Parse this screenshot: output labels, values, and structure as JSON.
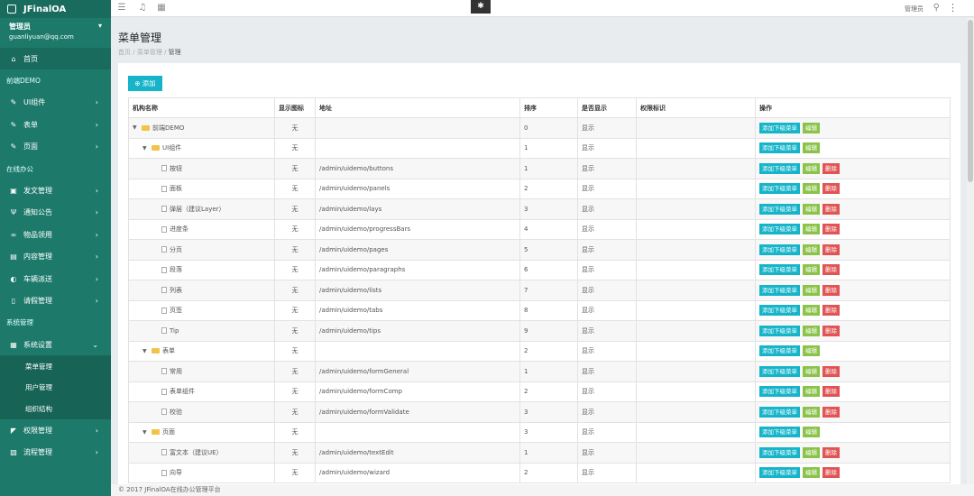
{
  "app": {
    "title": "JFinalOA"
  },
  "user": {
    "role": "管理员",
    "email": "guanliyuan@qq.com"
  },
  "sidebar": {
    "items": [
      {
        "type": "item",
        "label": "首页",
        "icon": "home-icon",
        "glyph": "⌂",
        "active": true
      },
      {
        "type": "header",
        "label": "前端DEMO"
      },
      {
        "type": "item",
        "label": "UI组件",
        "icon": "pencil-icon",
        "glyph": "✎",
        "chevron": "›"
      },
      {
        "type": "item",
        "label": "表单",
        "icon": "pencil-icon",
        "glyph": "✎",
        "chevron": "›"
      },
      {
        "type": "item",
        "label": "页面",
        "icon": "pencil-icon",
        "glyph": "✎",
        "chevron": "›"
      },
      {
        "type": "header",
        "label": "在线办公"
      },
      {
        "type": "item",
        "label": "发文管理",
        "icon": "calendar-icon",
        "glyph": "▣",
        "chevron": "›"
      },
      {
        "type": "item",
        "label": "通知公告",
        "icon": "antenna-icon",
        "glyph": "Ψ",
        "chevron": "›"
      },
      {
        "type": "item",
        "label": "物品领用",
        "icon": "link-icon",
        "glyph": "∞",
        "chevron": "›"
      },
      {
        "type": "item",
        "label": "内容管理",
        "icon": "inbox-icon",
        "glyph": "▤",
        "chevron": "›"
      },
      {
        "type": "item",
        "label": "车辆派送",
        "icon": "car-icon",
        "glyph": "◐",
        "chevron": "›"
      },
      {
        "type": "item",
        "label": "请假管理",
        "icon": "document-icon",
        "glyph": "▯",
        "chevron": "›"
      },
      {
        "type": "header",
        "label": "系统管理"
      },
      {
        "type": "item",
        "label": "系统设置",
        "icon": "save-icon",
        "glyph": "▦",
        "chevron": "⌄"
      },
      {
        "type": "sub",
        "label": "菜单管理"
      },
      {
        "type": "sub",
        "label": "用户管理"
      },
      {
        "type": "sub",
        "label": "组织结构"
      },
      {
        "type": "item",
        "label": "权限管理",
        "icon": "key-icon",
        "glyph": "◤",
        "chevron": "›"
      },
      {
        "type": "item",
        "label": "流程管理",
        "icon": "flow-icon",
        "glyph": "▧",
        "chevron": "›"
      }
    ]
  },
  "topbar": {
    "admin_label": "管理员"
  },
  "page": {
    "title": "菜单管理",
    "breadcrumb": [
      "首页",
      "菜单管理",
      "管理"
    ],
    "add_label": "添加"
  },
  "table": {
    "headers": [
      "机构名称",
      "显示图标",
      "地址",
      "排序",
      "是否显示",
      "权限标识",
      "操作"
    ],
    "btn_add_child": "添加下级菜单",
    "btn_edit": "编辑",
    "btn_delete": "删除",
    "rows": [
      {
        "level": 0,
        "kind": "folder",
        "name": "前端DEMO",
        "icon": "无",
        "url": "",
        "order": "0",
        "show": "显示",
        "perm": "",
        "del": false
      },
      {
        "level": 1,
        "kind": "folder",
        "name": "UI组件",
        "icon": "无",
        "url": "",
        "order": "1",
        "show": "显示",
        "perm": "",
        "del": false
      },
      {
        "level": 2,
        "kind": "file",
        "name": "按钮",
        "icon": "无",
        "url": "/admin/uidemo/buttons",
        "order": "1",
        "show": "显示",
        "perm": "",
        "del": true
      },
      {
        "level": 2,
        "kind": "file",
        "name": "面板",
        "icon": "无",
        "url": "/admin/uidemo/panels",
        "order": "2",
        "show": "显示",
        "perm": "",
        "del": true
      },
      {
        "level": 2,
        "kind": "file",
        "name": "弹层（建议Layer）",
        "icon": "无",
        "url": "/admin/uidemo/lays",
        "order": "3",
        "show": "显示",
        "perm": "",
        "del": true
      },
      {
        "level": 2,
        "kind": "file",
        "name": "进度条",
        "icon": "无",
        "url": "/admin/uidemo/progressBars",
        "order": "4",
        "show": "显示",
        "perm": "",
        "del": true
      },
      {
        "level": 2,
        "kind": "file",
        "name": "分页",
        "icon": "无",
        "url": "/admin/uidemo/pages",
        "order": "5",
        "show": "显示",
        "perm": "",
        "del": true
      },
      {
        "level": 2,
        "kind": "file",
        "name": "段落",
        "icon": "无",
        "url": "/admin/uidemo/paragraphs",
        "order": "6",
        "show": "显示",
        "perm": "",
        "del": true
      },
      {
        "level": 2,
        "kind": "file",
        "name": "列表",
        "icon": "无",
        "url": "/admin/uidemo/lists",
        "order": "7",
        "show": "显示",
        "perm": "",
        "del": true
      },
      {
        "level": 2,
        "kind": "file",
        "name": "页签",
        "icon": "无",
        "url": "/admin/uidemo/tabs",
        "order": "8",
        "show": "显示",
        "perm": "",
        "del": true
      },
      {
        "level": 2,
        "kind": "file",
        "name": "Tip",
        "icon": "无",
        "url": "/admin/uidemo/tips",
        "order": "9",
        "show": "显示",
        "perm": "",
        "del": true
      },
      {
        "level": 1,
        "kind": "folder",
        "name": "表单",
        "icon": "无",
        "url": "",
        "order": "2",
        "show": "显示",
        "perm": "",
        "del": false
      },
      {
        "level": 2,
        "kind": "file",
        "name": "常用",
        "icon": "无",
        "url": "/admin/uidemo/formGeneral",
        "order": "1",
        "show": "显示",
        "perm": "",
        "del": true
      },
      {
        "level": 2,
        "kind": "file",
        "name": "表单组件",
        "icon": "无",
        "url": "/admin/uidemo/formComp",
        "order": "2",
        "show": "显示",
        "perm": "",
        "del": true
      },
      {
        "level": 2,
        "kind": "file",
        "name": "校验",
        "icon": "无",
        "url": "/admin/uidemo/formValidate",
        "order": "3",
        "show": "显示",
        "perm": "",
        "del": true
      },
      {
        "level": 1,
        "kind": "folder",
        "name": "页面",
        "icon": "无",
        "url": "",
        "order": "3",
        "show": "显示",
        "perm": "",
        "del": false
      },
      {
        "level": 2,
        "kind": "file",
        "name": "富文本（建议UE）",
        "icon": "无",
        "url": "/admin/uidemo/textEdit",
        "order": "1",
        "show": "显示",
        "perm": "",
        "del": true
      },
      {
        "level": 2,
        "kind": "file",
        "name": "向导",
        "icon": "无",
        "url": "/admin/uidemo/wizard",
        "order": "2",
        "show": "显示",
        "perm": "",
        "del": true
      }
    ]
  },
  "footer": {
    "text": "© 2017 JFinalOA在线办公管理平台"
  },
  "colors": {
    "sidebar": "#1d7a6b",
    "accent": "#16b4c9",
    "edit": "#8bc34a",
    "danger": "#e05454"
  }
}
